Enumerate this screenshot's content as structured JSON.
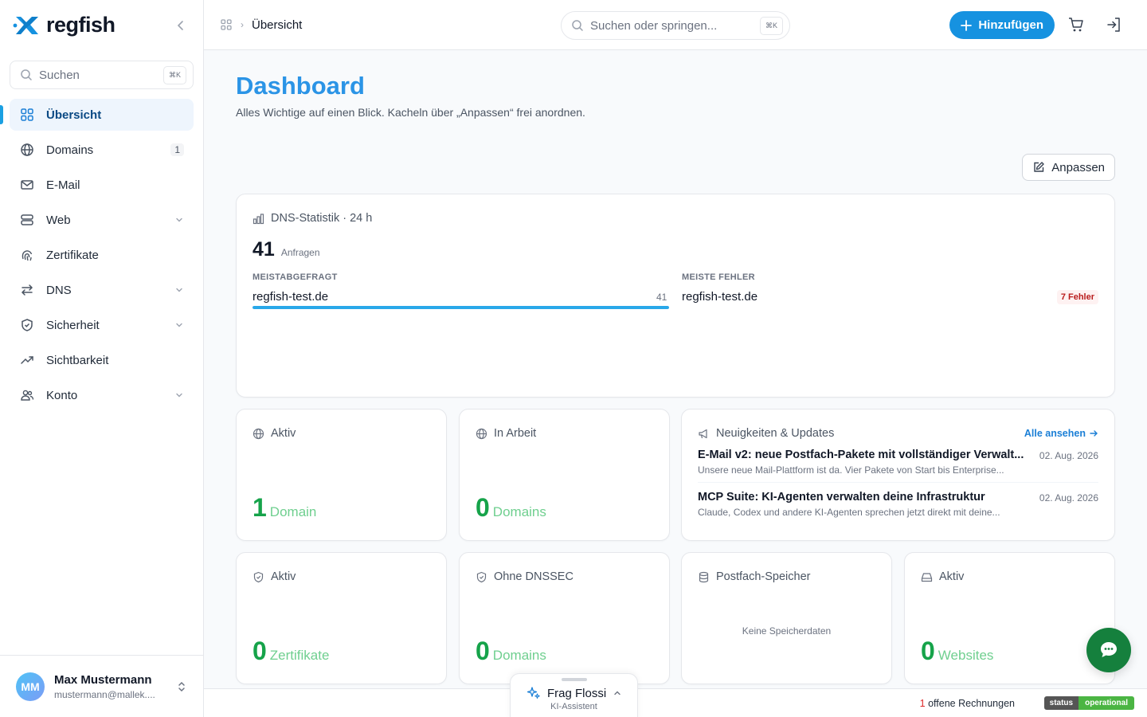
{
  "brand": {
    "name": "regfish"
  },
  "sidebar": {
    "search_placeholder": "Suchen",
    "search_shortcut": "⌘K",
    "items": [
      {
        "label": "Übersicht",
        "icon": "grid-icon",
        "active": true
      },
      {
        "label": "Domains",
        "icon": "globe-icon",
        "badge": "1"
      },
      {
        "label": "E-Mail",
        "icon": "mail-icon"
      },
      {
        "label": "Web",
        "icon": "server-icon",
        "expandable": true
      },
      {
        "label": "Zertifikate",
        "icon": "fingerprint-icon"
      },
      {
        "label": "DNS",
        "icon": "arrows-icon",
        "expandable": true
      },
      {
        "label": "Sicherheit",
        "icon": "shield-icon",
        "expandable": true
      },
      {
        "label": "Sichtbarkeit",
        "icon": "trending-icon"
      },
      {
        "label": "Konto",
        "icon": "users-icon",
        "expandable": true
      }
    ]
  },
  "user": {
    "initials": "MM",
    "name": "Max Mustermann",
    "email": "mustermann@mallek...."
  },
  "topbar": {
    "breadcrumb": "Übersicht",
    "search_placeholder": "Suchen oder springen...",
    "search_shortcut": "⌘K",
    "add_label": "Hinzufügen"
  },
  "page": {
    "title": "Dashboard",
    "subtitle": "Alles Wichtige auf einen Blick. Kacheln über „Anpassen“ frei anordnen.",
    "customize_label": "Anpassen"
  },
  "dns": {
    "title": "DNS-Statistik · 24 h",
    "total": "41",
    "total_unit": "Anfragen",
    "top_label": "MEISTABGEFRAGT",
    "top_domain": "regfish-test.de",
    "top_count": "41",
    "top_fraction": 1.0,
    "errors_label": "MEISTE FEHLER",
    "errors_domain": "regfish-test.de",
    "errors_badge": "7 Fehler"
  },
  "tiles": {
    "domains_active": {
      "title": "Aktiv",
      "value": "1",
      "unit": "Domain"
    },
    "domains_pending": {
      "title": "In Arbeit",
      "value": "0",
      "unit": "Domains"
    },
    "certs_active": {
      "title": "Aktiv",
      "value": "0",
      "unit": "Zertifikate"
    },
    "no_dnssec": {
      "title": "Ohne DNSSEC",
      "value": "0",
      "unit": "Domains"
    },
    "mail_storage": {
      "title": "Postfach-Speicher",
      "empty": "Keine Speicherdaten"
    },
    "websites_active": {
      "title": "Aktiv",
      "value": "0",
      "unit": "Websites"
    }
  },
  "news": {
    "title": "Neuigkeiten & Updates",
    "all_label": "Alle ansehen",
    "items": [
      {
        "title": "E-Mail v2: neue Postfach-Pakete mit vollständiger Verwalt...",
        "desc": "Unsere neue Mail-Plattform ist da. Vier Pakete von Start bis Enterprise...",
        "date": "02. Aug. 2026"
      },
      {
        "title": "MCP Suite: KI-Agenten verwalten deine Infrastruktur",
        "desc": "Claude, Codex und andere KI-Agenten sprechen jetzt direkt mit deine...",
        "date": "02. Aug. 2026"
      }
    ]
  },
  "footer": {
    "invoices_count": "1",
    "invoices_label": "offene Rechnungen",
    "status_left": "status",
    "status_right": "operational"
  },
  "assistant": {
    "title": "Frag Flossi",
    "subtitle": "KI-Assistent"
  },
  "colors": {
    "accent": "#1692e0",
    "success": "#16a34a",
    "chat": "#15803d"
  }
}
